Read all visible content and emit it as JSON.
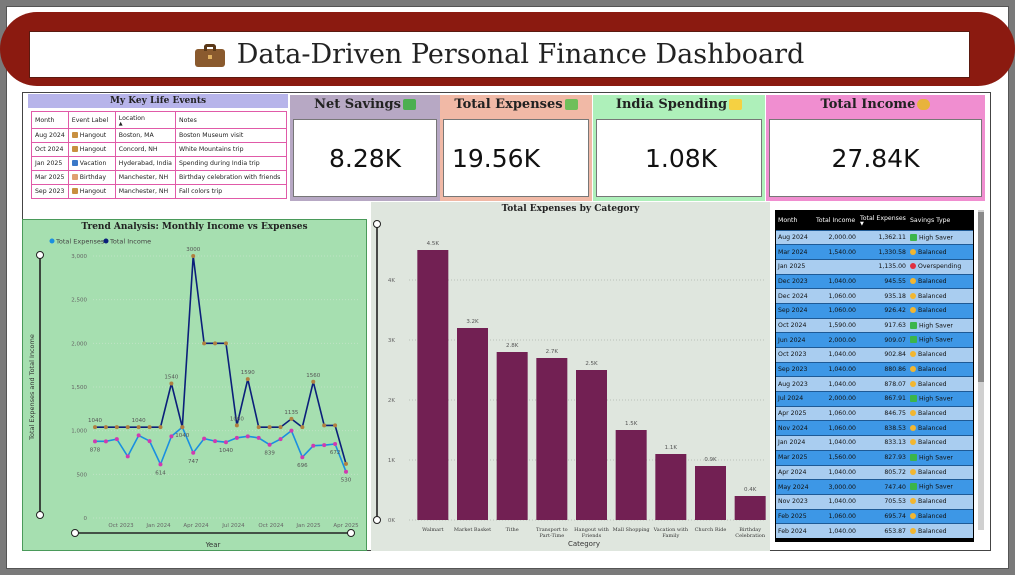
{
  "title": "Data-Driven Personal Finance Dashboard",
  "colors": {
    "banner": "#8b1a10",
    "bar": "#722053",
    "expense_line": "#1a8fe0",
    "income_line": "#0b1f7a",
    "expense_marker": "#d03ab0",
    "income_marker": "#b08040"
  },
  "events": {
    "title": "My Key Life Events",
    "columns": [
      "Month",
      "Event Label",
      "Location",
      "Notes"
    ],
    "rows": [
      {
        "month": "Aug 2024",
        "label": "Hangout",
        "icon": "people-icon",
        "location": "Boston, MA",
        "notes": "Boston Museum visit"
      },
      {
        "month": "Oct 2024",
        "label": "Hangout",
        "icon": "people-icon",
        "location": "Concord, NH",
        "notes": "White Mountains trip"
      },
      {
        "month": "Jan 2025",
        "label": "Vacation",
        "icon": "airplane-icon",
        "location": "Hyderabad, India",
        "notes": "Spending during India trip"
      },
      {
        "month": "Mar 2025",
        "label": "Birthday",
        "icon": "cake-icon",
        "location": "Manchester, NH",
        "notes": "Birthday celebration with friends"
      },
      {
        "month": "Sep 2023",
        "label": "Hangout",
        "icon": "people-icon",
        "location": "Manchester, NH",
        "notes": "Fall colors trip"
      }
    ]
  },
  "kpis": {
    "net_savings": {
      "label": "Net Savings",
      "value": "8.28K",
      "icon": "money-icon"
    },
    "total_expenses": {
      "label": "Total Expenses",
      "value": "19.56K",
      "icon": "flying-money-icon"
    },
    "india_spending": {
      "label": "India Spending",
      "value": "1.08K",
      "icon": "sparkles-icon"
    },
    "total_income": {
      "label": "Total Income",
      "value": "27.84K",
      "icon": "money-bag-icon"
    }
  },
  "chart_data": [
    {
      "type": "line",
      "title": "Trend Analysis: Monthly Income vs Expenses",
      "xlabel": "Year",
      "ylabel": "Total Expenses and Total Income",
      "x_ticks": [
        "Oct 2023",
        "Jan 2024",
        "Apr 2024",
        "Jul 2024",
        "Oct 2024",
        "Jan 2025",
        "Apr 2025"
      ],
      "y_ticks": [
        0,
        500,
        1000,
        1500,
        2000,
        2500,
        3000
      ],
      "ylim": [
        0,
        3000
      ],
      "legend": "top-left",
      "series": [
        {
          "name": "Total Expenses",
          "values": [
            878,
            878,
            903,
            705,
            946,
            880,
            614,
            935,
            1040,
            747,
            909,
            880,
            868,
            918,
            935,
            917,
            839,
            903,
            1000,
            696,
            828,
            834,
            847,
            530
          ]
        },
        {
          "name": "Total Income",
          "values": [
            1040,
            1040,
            1040,
            1040,
            1040,
            1040,
            1040,
            1540,
            1040,
            3000,
            2000,
            2000,
            2000,
            1060,
            1590,
            1040,
            1040,
            1040,
            1135,
            1040,
            1560,
            1060,
            1060,
            620
          ]
        }
      ],
      "point_labels": {
        "income": [
          {
            "i": 0,
            "text": "1040"
          },
          {
            "i": 4,
            "text": "1040"
          },
          {
            "i": 7,
            "text": "1540"
          },
          {
            "i": 9,
            "text": "3000"
          },
          {
            "i": 14,
            "text": "1590"
          },
          {
            "i": 18,
            "text": "1135"
          },
          {
            "i": 20,
            "text": "1560"
          },
          {
            "i": 13,
            "text": "1060"
          }
        ],
        "expenses": [
          {
            "i": 0,
            "text": "878"
          },
          {
            "i": 6,
            "text": "614"
          },
          {
            "i": 8,
            "text": "1040"
          },
          {
            "i": 9,
            "text": "747"
          },
          {
            "i": 12,
            "text": "1040"
          },
          {
            "i": 16,
            "text": "839"
          },
          {
            "i": 19,
            "text": "696"
          },
          {
            "i": 23,
            "text": "530"
          },
          {
            "i": 22,
            "text": "672"
          }
        ]
      }
    },
    {
      "type": "bar",
      "title": "Total Expenses by Category",
      "xlabel": "Category",
      "ylabel": "",
      "categories": [
        "Walmart",
        "Market Basket",
        "Tithe",
        "Transport to Part-Time",
        "Hangout with Friends",
        "Mall Shopping",
        "Vacation with Family",
        "Church Ride",
        "Birthday Celebration"
      ],
      "values": [
        4.5,
        3.2,
        2.8,
        2.7,
        2.5,
        1.5,
        1.1,
        0.9,
        0.4
      ],
      "data_labels": [
        "4.5K",
        "3.2K",
        "2.8K",
        "2.7K",
        "2.5K",
        "1.5K",
        "1.1K",
        "0.9K",
        "0.4K"
      ],
      "y_ticks": [
        "0K",
        "1K",
        "2K",
        "3K",
        "4K"
      ],
      "ylim": [
        0,
        4.8
      ]
    }
  ],
  "savings": {
    "columns": [
      "Month",
      "Total Income",
      "Total Expenses",
      "Savings Type"
    ],
    "rows": [
      {
        "month": "Aug 2024",
        "income": "2,000.00",
        "expenses": "1,362.11",
        "type": "High Saver"
      },
      {
        "month": "Mar 2024",
        "income": "1,540.00",
        "expenses": "1,330.58",
        "type": "Balanced"
      },
      {
        "month": "Jan 2025",
        "income": "",
        "expenses": "1,135.00",
        "type": "Overspending"
      },
      {
        "month": "Dec 2023",
        "income": "1,040.00",
        "expenses": "945.55",
        "type": "Balanced"
      },
      {
        "month": "Dec 2024",
        "income": "1,060.00",
        "expenses": "935.18",
        "type": "Balanced"
      },
      {
        "month": "Sep 2024",
        "income": "1,060.00",
        "expenses": "926.42",
        "type": "Balanced"
      },
      {
        "month": "Oct 2024",
        "income": "1,590.00",
        "expenses": "917.63",
        "type": "High Saver"
      },
      {
        "month": "Jun 2024",
        "income": "2,000.00",
        "expenses": "909.07",
        "type": "High Saver"
      },
      {
        "month": "Oct 2023",
        "income": "1,040.00",
        "expenses": "902.84",
        "type": "Balanced"
      },
      {
        "month": "Sep 2023",
        "income": "1,040.00",
        "expenses": "880.86",
        "type": "Balanced"
      },
      {
        "month": "Aug 2023",
        "income": "1,040.00",
        "expenses": "878.07",
        "type": "Balanced"
      },
      {
        "month": "Jul 2024",
        "income": "2,000.00",
        "expenses": "867.91",
        "type": "High Saver"
      },
      {
        "month": "Apr 2025",
        "income": "1,060.00",
        "expenses": "846.75",
        "type": "Balanced"
      },
      {
        "month": "Nov 2024",
        "income": "1,060.00",
        "expenses": "838.53",
        "type": "Balanced"
      },
      {
        "month": "Jan 2024",
        "income": "1,040.00",
        "expenses": "833.13",
        "type": "Balanced"
      },
      {
        "month": "Mar 2025",
        "income": "1,560.00",
        "expenses": "827.93",
        "type": "High Saver"
      },
      {
        "month": "Apr 2024",
        "income": "1,040.00",
        "expenses": "805.72",
        "type": "Balanced"
      },
      {
        "month": "May 2024",
        "income": "3,000.00",
        "expenses": "747.40",
        "type": "High Saver"
      },
      {
        "month": "Nov 2023",
        "income": "1,040.00",
        "expenses": "705.53",
        "type": "Balanced"
      },
      {
        "month": "Feb 2025",
        "income": "1,060.00",
        "expenses": "695.74",
        "type": "Balanced"
      },
      {
        "month": "Feb 2024",
        "income": "1,040.00",
        "expenses": "653.87",
        "type": "Balanced"
      }
    ]
  }
}
